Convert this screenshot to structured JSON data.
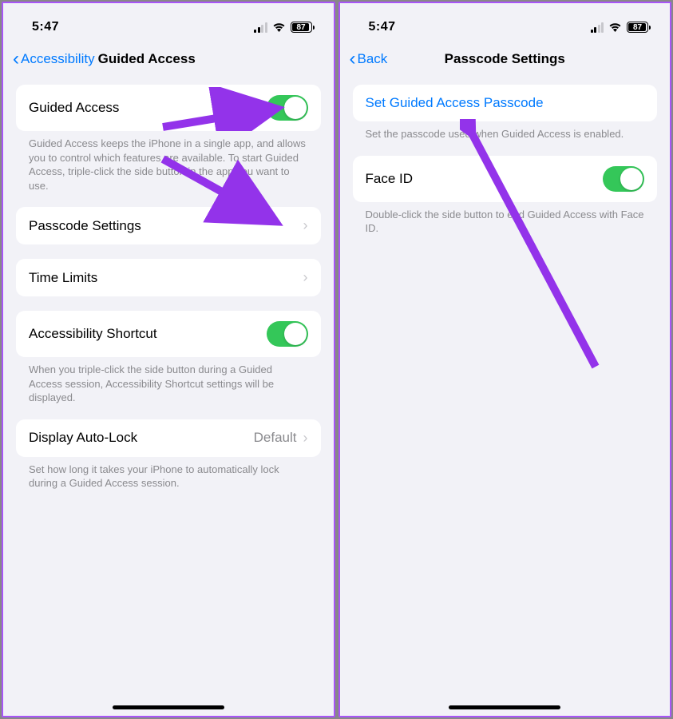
{
  "status": {
    "time": "5:47",
    "battery_pct": "87"
  },
  "left": {
    "back_label": "Accessibility",
    "title": "Guided Access",
    "rows": {
      "guided_access": "Guided Access",
      "passcode_settings": "Passcode Settings",
      "time_limits": "Time Limits",
      "accessibility_shortcut": "Accessibility Shortcut",
      "display_auto_lock": "Display Auto-Lock",
      "display_auto_lock_value": "Default"
    },
    "footers": {
      "guided_access": "Guided Access keeps the iPhone in a single app, and allows you to control which features are available. To start Guided Access, triple-click the side button in the app you want to use.",
      "accessibility_shortcut": "When you triple-click the side button during a Guided Access session, Accessibility Shortcut settings will be displayed.",
      "display_auto_lock": "Set how long it takes your iPhone to automatically lock during a Guided Access session."
    }
  },
  "right": {
    "back_label": "Back",
    "title": "Passcode Settings",
    "rows": {
      "set_passcode": "Set Guided Access Passcode",
      "face_id": "Face ID"
    },
    "footers": {
      "set_passcode": "Set the passcode used when Guided Access is enabled.",
      "face_id": "Double-click the side button to end Guided Access with Face ID."
    }
  }
}
